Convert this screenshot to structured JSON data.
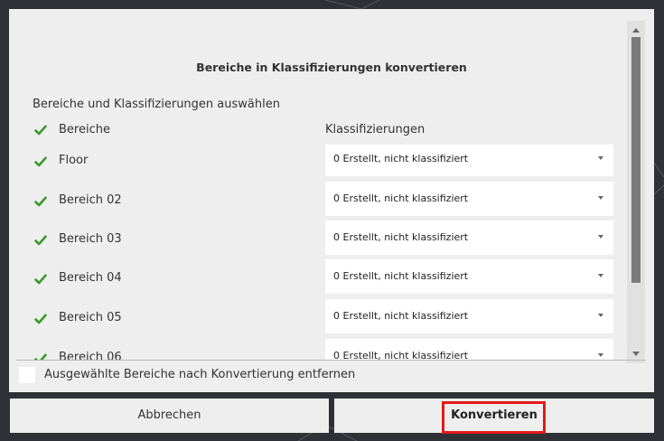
{
  "dialog": {
    "title": "Bereiche in Klassifizierungen konvertieren",
    "subtitle": "Bereiche und Klassifizierungen auswählen",
    "header_check_label": "Bereiche",
    "column_header": "Klassifizierungen",
    "rows": [
      {
        "label": "Floor",
        "checked": true,
        "classification": "0 Erstellt, nicht klassifiziert"
      },
      {
        "label": "Bereich 02",
        "checked": true,
        "classification": "0 Erstellt, nicht klassifiziert"
      },
      {
        "label": "Bereich 03",
        "checked": true,
        "classification": "0 Erstellt, nicht klassifiziert"
      },
      {
        "label": "Bereich 04",
        "checked": true,
        "classification": "0 Erstellt, nicht klassifiziert"
      },
      {
        "label": "Bereich 05",
        "checked": true,
        "classification": "0 Erstellt, nicht klassifiziert"
      },
      {
        "label": "Bereich 06",
        "checked": true,
        "classification": "0 Erstellt, nicht klassifiziert"
      }
    ],
    "remove_option_label": "Ausgewählte Bereiche nach Konvertierung entfernen",
    "remove_option_checked": false
  },
  "buttons": {
    "cancel": "Abbrechen",
    "convert": "Konvertieren"
  },
  "colors": {
    "check": "#3a9a2a",
    "highlight": "#e21a1a",
    "dialog_bg": "#eeeeee"
  }
}
